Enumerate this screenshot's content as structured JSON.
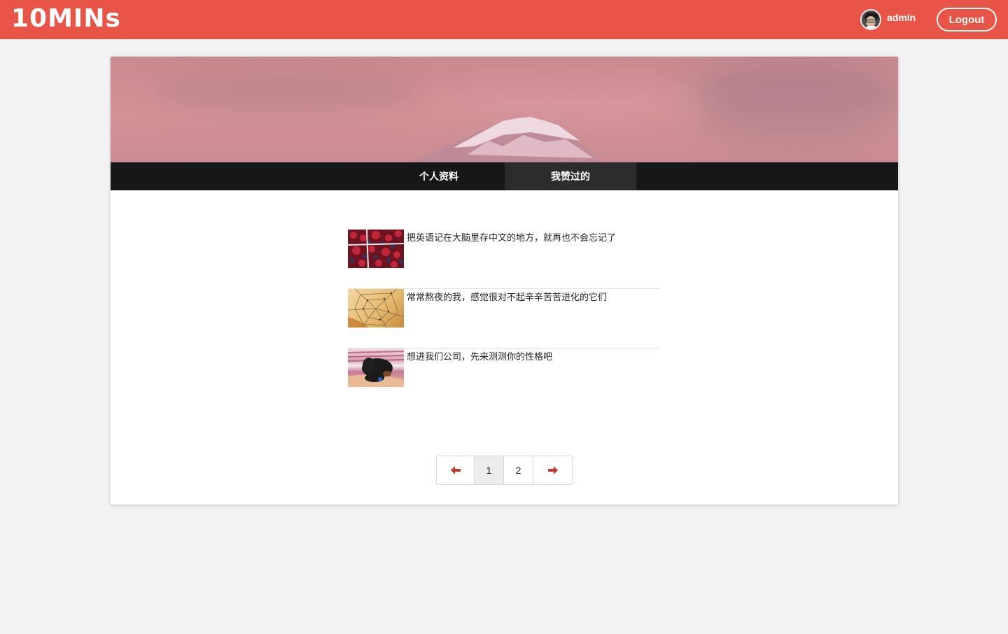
{
  "header": {
    "logo": "10MINs",
    "username": "admin",
    "logout_label": "Logout"
  },
  "tabs": [
    {
      "label": "个人资料"
    },
    {
      "label": "我赞过的",
      "active": true
    }
  ],
  "liked_items": [
    {
      "title": "把英语记在大脑里存中文的地方，就再也不会忘记了",
      "thumbnail": "berries"
    },
    {
      "title": "常常熬夜的我，感觉很对不起辛辛苦苦进化的它们",
      "thumbnail": "spider-web"
    },
    {
      "title": "想进我们公司，先来测测你的性格吧",
      "thumbnail": "puppy"
    }
  ],
  "pagination": {
    "prev_icon": "arrow-left-icon",
    "pages": [
      "1",
      "2"
    ],
    "current": "1",
    "next_icon": "arrow-right-icon"
  },
  "colors": {
    "brand": "#e85446",
    "tab_bar": "#161717",
    "arrow": "#c0392b"
  }
}
